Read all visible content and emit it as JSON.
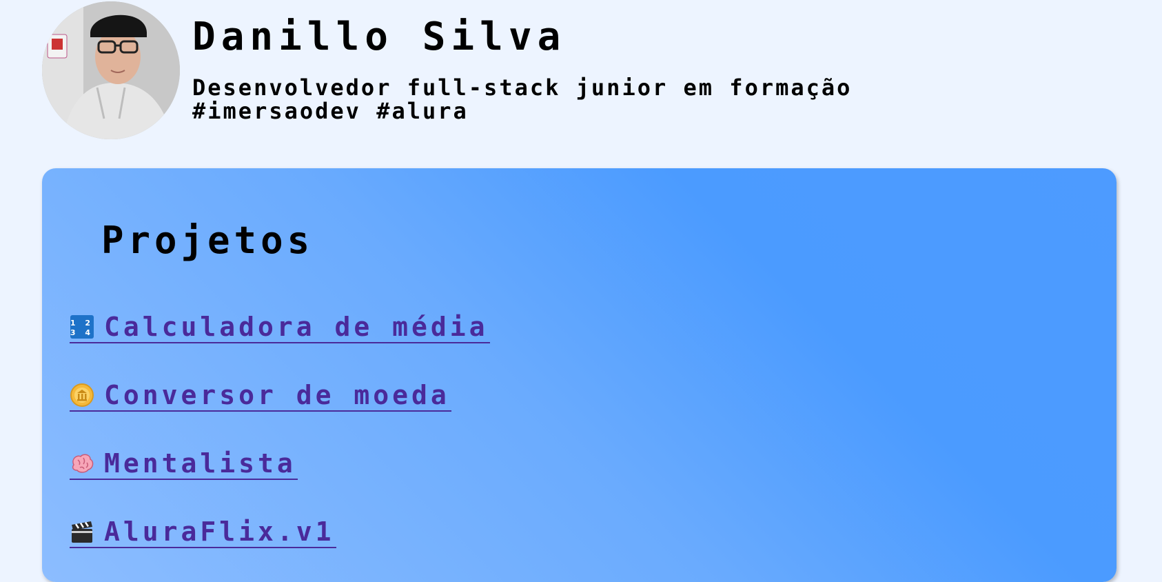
{
  "profile": {
    "name": "Danillo Silva",
    "bio_line1": "Desenvolvedor full-stack junior em formação",
    "bio_line2": "#imersaodev #alura"
  },
  "projects": {
    "title": "Projetos",
    "items": [
      {
        "label": "Calculadora de média",
        "icon": "input-numbers-icon"
      },
      {
        "label": "Conversor de moeda",
        "icon": "coin-icon"
      },
      {
        "label": "Mentalista",
        "icon": "brain-icon"
      },
      {
        "label": "AluraFlix.v1",
        "icon": "clapper-board-icon"
      }
    ]
  },
  "colors": {
    "background": "#edf4ff",
    "panel_gradient_start": "#4d9bff",
    "panel_gradient_end": "#8cbdff",
    "link": "#4a2a9a"
  }
}
